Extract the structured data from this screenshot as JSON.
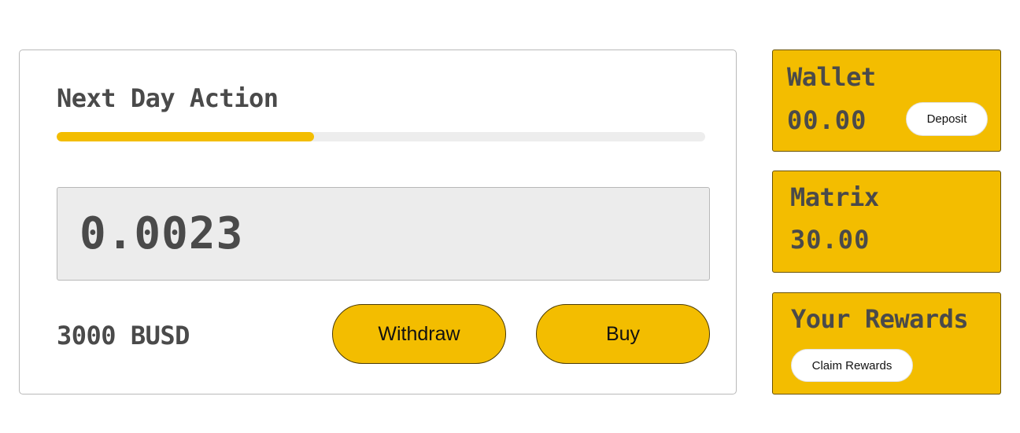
{
  "action_card": {
    "title": "Next Day Action",
    "progress_fraction": 0.397,
    "amount": "0.0023",
    "balance": "3000 BUSD",
    "withdraw_label": "Withdraw",
    "buy_label": "Buy"
  },
  "wallet": {
    "title": "Wallet",
    "value": "00.00",
    "deposit_label": "Deposit"
  },
  "matrix": {
    "title": "Matrix",
    "value": "30.00"
  },
  "rewards": {
    "title": "Your Rewards",
    "claim_label": "Claim Rewards"
  },
  "colors": {
    "accent": "#f3bd00",
    "text_dark": "#4a4a4a",
    "field_bg": "#ececec",
    "track_bg": "#ededed"
  }
}
